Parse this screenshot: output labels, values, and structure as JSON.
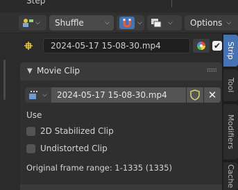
{
  "header_top": {
    "step_label": "Step"
  },
  "toolbar": {
    "transform_pivot_label": "Shuffle",
    "options_label": "Options"
  },
  "strip": {
    "name": "2024-05-17 15-08-30.mp4",
    "enabled": true
  },
  "section": {
    "title": "Movie Clip"
  },
  "clip": {
    "name": "2024-05-17 15-08-30.mp4",
    "use_label": "Use",
    "options": [
      {
        "label": "2D Stabilized Clip",
        "checked": false
      },
      {
        "label": "Undistorted Clip",
        "checked": false
      }
    ],
    "frame_range_text": "Original frame range: 1-1335 (1335)"
  },
  "tabs": [
    {
      "label": "Strip",
      "active": true
    },
    {
      "label": "Tool",
      "active": false
    },
    {
      "label": "Modifiers",
      "active": false
    },
    {
      "label": "Cache",
      "active": false
    }
  ],
  "colors": {
    "accent": "#4772b3",
    "strip_icon": "#e8c33a",
    "fake_user_outline": "#c8d16a",
    "snap_icon": "#e8603a"
  },
  "icons": {
    "view_type": "sequencer-view-icon",
    "snap": "magnet-snap-icon",
    "overlay": "overlay-icon",
    "strip_type": "strip-transform-icon",
    "strip_color": "color-wheel-icon",
    "clip_browse": "movie-clip-browse-icon",
    "fake_user": "shield-icon",
    "unlink": "close-icon"
  }
}
